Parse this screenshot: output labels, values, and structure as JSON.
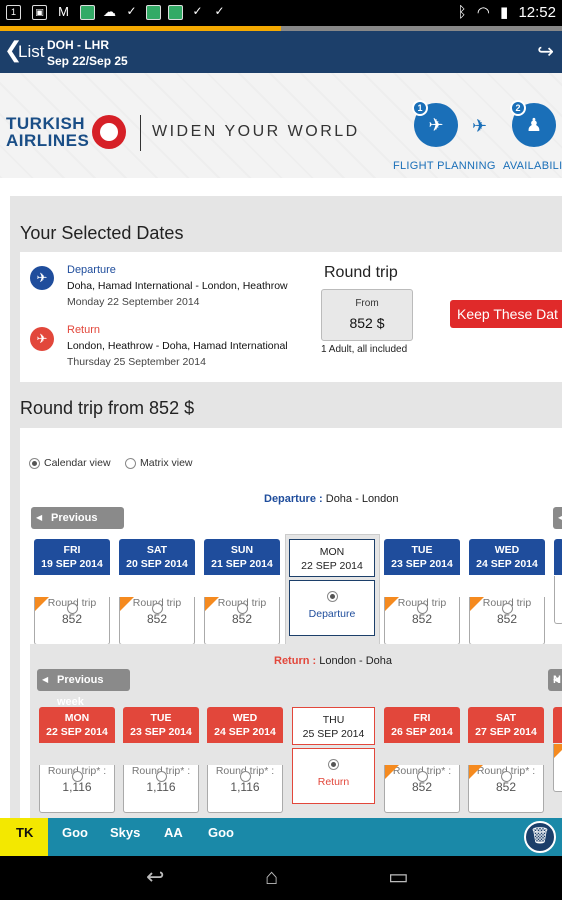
{
  "statusbar": {
    "time": "12:52",
    "notif1": "1"
  },
  "appbar": {
    "back_label": "List",
    "route": "DOH - LHR",
    "dates": "Sep 22/Sep 25"
  },
  "banner": {
    "logo_line1": "TURKISH",
    "logo_line2": "AIRLINES",
    "slogan": "WIDEN YOUR WORLD",
    "steps": [
      {
        "num": "1",
        "label": "FLIGHT PLANNING"
      },
      {
        "num": "2",
        "label": "AVAILABILI"
      }
    ]
  },
  "selected": {
    "title": "Your Selected Dates",
    "departure": {
      "label": "Departure",
      "route": "Doha, Hamad International - London, Heathrow",
      "date": "Monday 22 September 2014"
    },
    "return": {
      "label": "Return",
      "route": "London, Heathrow - Doha, Hamad International",
      "date": "Thursday 25 September 2014"
    },
    "trip_type": "Round trip",
    "from_label": "From",
    "price": "852 $",
    "pax": "1 Adult, all included",
    "keep_label": "Keep These Dat"
  },
  "roundtrip": {
    "title": "Round trip from 852 $",
    "view_calendar": "Calendar view",
    "view_matrix": "Matrix view",
    "departure_prefix": "Departure :",
    "departure_route": "Doha - London",
    "return_prefix": "Return :",
    "return_route": "London - Doha",
    "prev_week": "Previous week",
    "next_week_partial": "N"
  },
  "dep_days": [
    {
      "dow": "FRI",
      "date": "19 SEP 2014",
      "label": "Round trip",
      "price": "852",
      "star": true
    },
    {
      "dow": "SAT",
      "date": "20 SEP 2014",
      "label": "Round trip",
      "price": "852",
      "star": true
    },
    {
      "dow": "SUN",
      "date": "21 SEP 2014",
      "label": "Round trip",
      "price": "852",
      "star": true
    },
    {
      "dow": "TUE",
      "date": "23 SEP 2014",
      "label": "Round trip",
      "price": "852",
      "star": true
    },
    {
      "dow": "WED",
      "date": "24 SEP 2014",
      "label": "Round trip",
      "price": "852",
      "star": true
    }
  ],
  "dep_selected": {
    "dow": "MON",
    "date": "22 SEP 2014",
    "label": "Departure"
  },
  "ret_days": [
    {
      "dow": "MON",
      "date": "22 SEP 2014",
      "label": "Round trip* :",
      "price": "1,116",
      "star": false
    },
    {
      "dow": "TUE",
      "date": "23 SEP 2014",
      "label": "Round trip* :",
      "price": "1,116",
      "star": false
    },
    {
      "dow": "WED",
      "date": "24 SEP 2014",
      "label": "Round trip* :",
      "price": "1,116",
      "star": false
    },
    {
      "dow": "FRI",
      "date": "26 SEP 2014",
      "label": "Round trip* :",
      "price": "852",
      "star": true
    },
    {
      "dow": "SAT",
      "date": "27 SEP 2014",
      "label": "Round trip* :",
      "price": "852",
      "star": true
    }
  ],
  "ret_selected": {
    "dow": "THU",
    "date": "25 SEP 2014",
    "label": "Return"
  },
  "tabs": [
    {
      "label": "TK",
      "active": true
    },
    {
      "label": "Goo"
    },
    {
      "label": "Skys"
    },
    {
      "label": "AA"
    },
    {
      "label": "Goo"
    }
  ],
  "colors": {
    "header_blue": "#1c3f6a",
    "dep_blue": "#1f4d9c",
    "ret_red": "#e2473b",
    "accent": "#1a89a8",
    "keep_red": "#e02a2a"
  }
}
